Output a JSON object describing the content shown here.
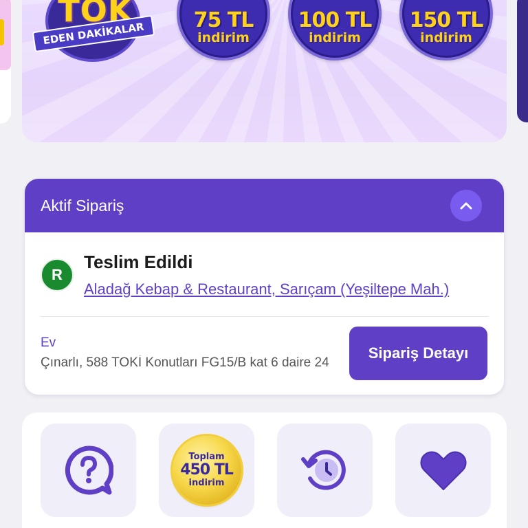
{
  "promo_banner": {
    "campaign_title": "TOK",
    "campaign_subtitle": "EDEN DAKİKALAR",
    "discounts": [
      {
        "amount": "75 TL",
        "label": "indirim"
      },
      {
        "amount": "100 TL",
        "label": "indirim"
      },
      {
        "amount": "150 TL",
        "label": "indirim"
      }
    ]
  },
  "active_order": {
    "title": "Aktif Sipariş",
    "status": "Teslim Edildi",
    "restaurant_initial": "R",
    "restaurant_name": "Aladağ Kebap & Restaurant, Sarıçam (Yeşiltepe Mah.)",
    "address_label": "Ev",
    "address": "Çınarlı, 588 TOKİ Konutları FG15/B kat 6 daire 24",
    "detail_button": "Sipariş Detayı"
  },
  "quick_actions": {
    "total_savings": {
      "top": "Toplam",
      "amount": "450 TL",
      "bottom": "indirim"
    },
    "icons": [
      "help-icon",
      "savings-coin-icon",
      "history-icon",
      "heart-icon"
    ]
  },
  "colors": {
    "brand_purple": "#5f3fc6",
    "accent_purple": "#7a5bef",
    "banner_lavender": "#e8dafd",
    "coin_gold": "#ffd21a",
    "status_green": "#1a8a2f"
  }
}
